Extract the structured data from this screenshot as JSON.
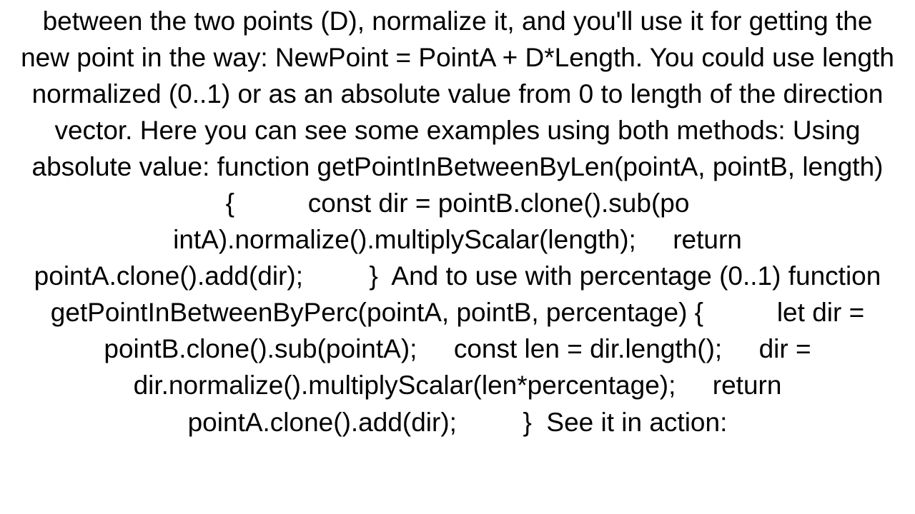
{
  "document": {
    "body": "between the two points (D), normalize it, and you'll use it for getting the new point in the way: NewPoint = PointA + D*Length. You could use length normalized (0..1) or as an absolute value from 0 to length of the direction vector. Here you can see some examples using both methods: Using absolute value: function getPointInBetweenByLen(pointA, pointB, length) {          const dir = pointB.clone().sub(po intA).normalize().multiplyScalar(length);     return pointA.clone().add(dir);         }  And to use with percentage (0..1) function getPointInBetweenByPerc(pointA, pointB, percentage) {          let dir = pointB.clone().sub(pointA);     const len = dir.length();     dir = dir.normalize().multiplyScalar(len*percentage);     return pointA.clone().add(dir);         }  See it in action:"
  }
}
